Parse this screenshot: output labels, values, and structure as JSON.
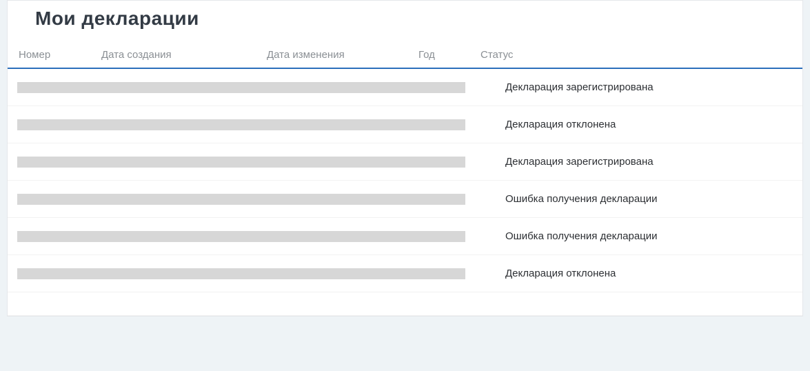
{
  "page_title": "Мои декларации",
  "columns": {
    "number": "Номер",
    "created": "Дата создания",
    "modified": "Дата изменения",
    "year": "Год",
    "status": "Статус"
  },
  "rows": [
    {
      "status": "Декларация зарегистрирована"
    },
    {
      "status": "Декларация отклонена"
    },
    {
      "status": "Декларация зарегистрирована"
    },
    {
      "status": "Ошибка получения декларации"
    },
    {
      "status": "Ошибка получения декларации"
    },
    {
      "status": "Декларация отклонена"
    }
  ]
}
